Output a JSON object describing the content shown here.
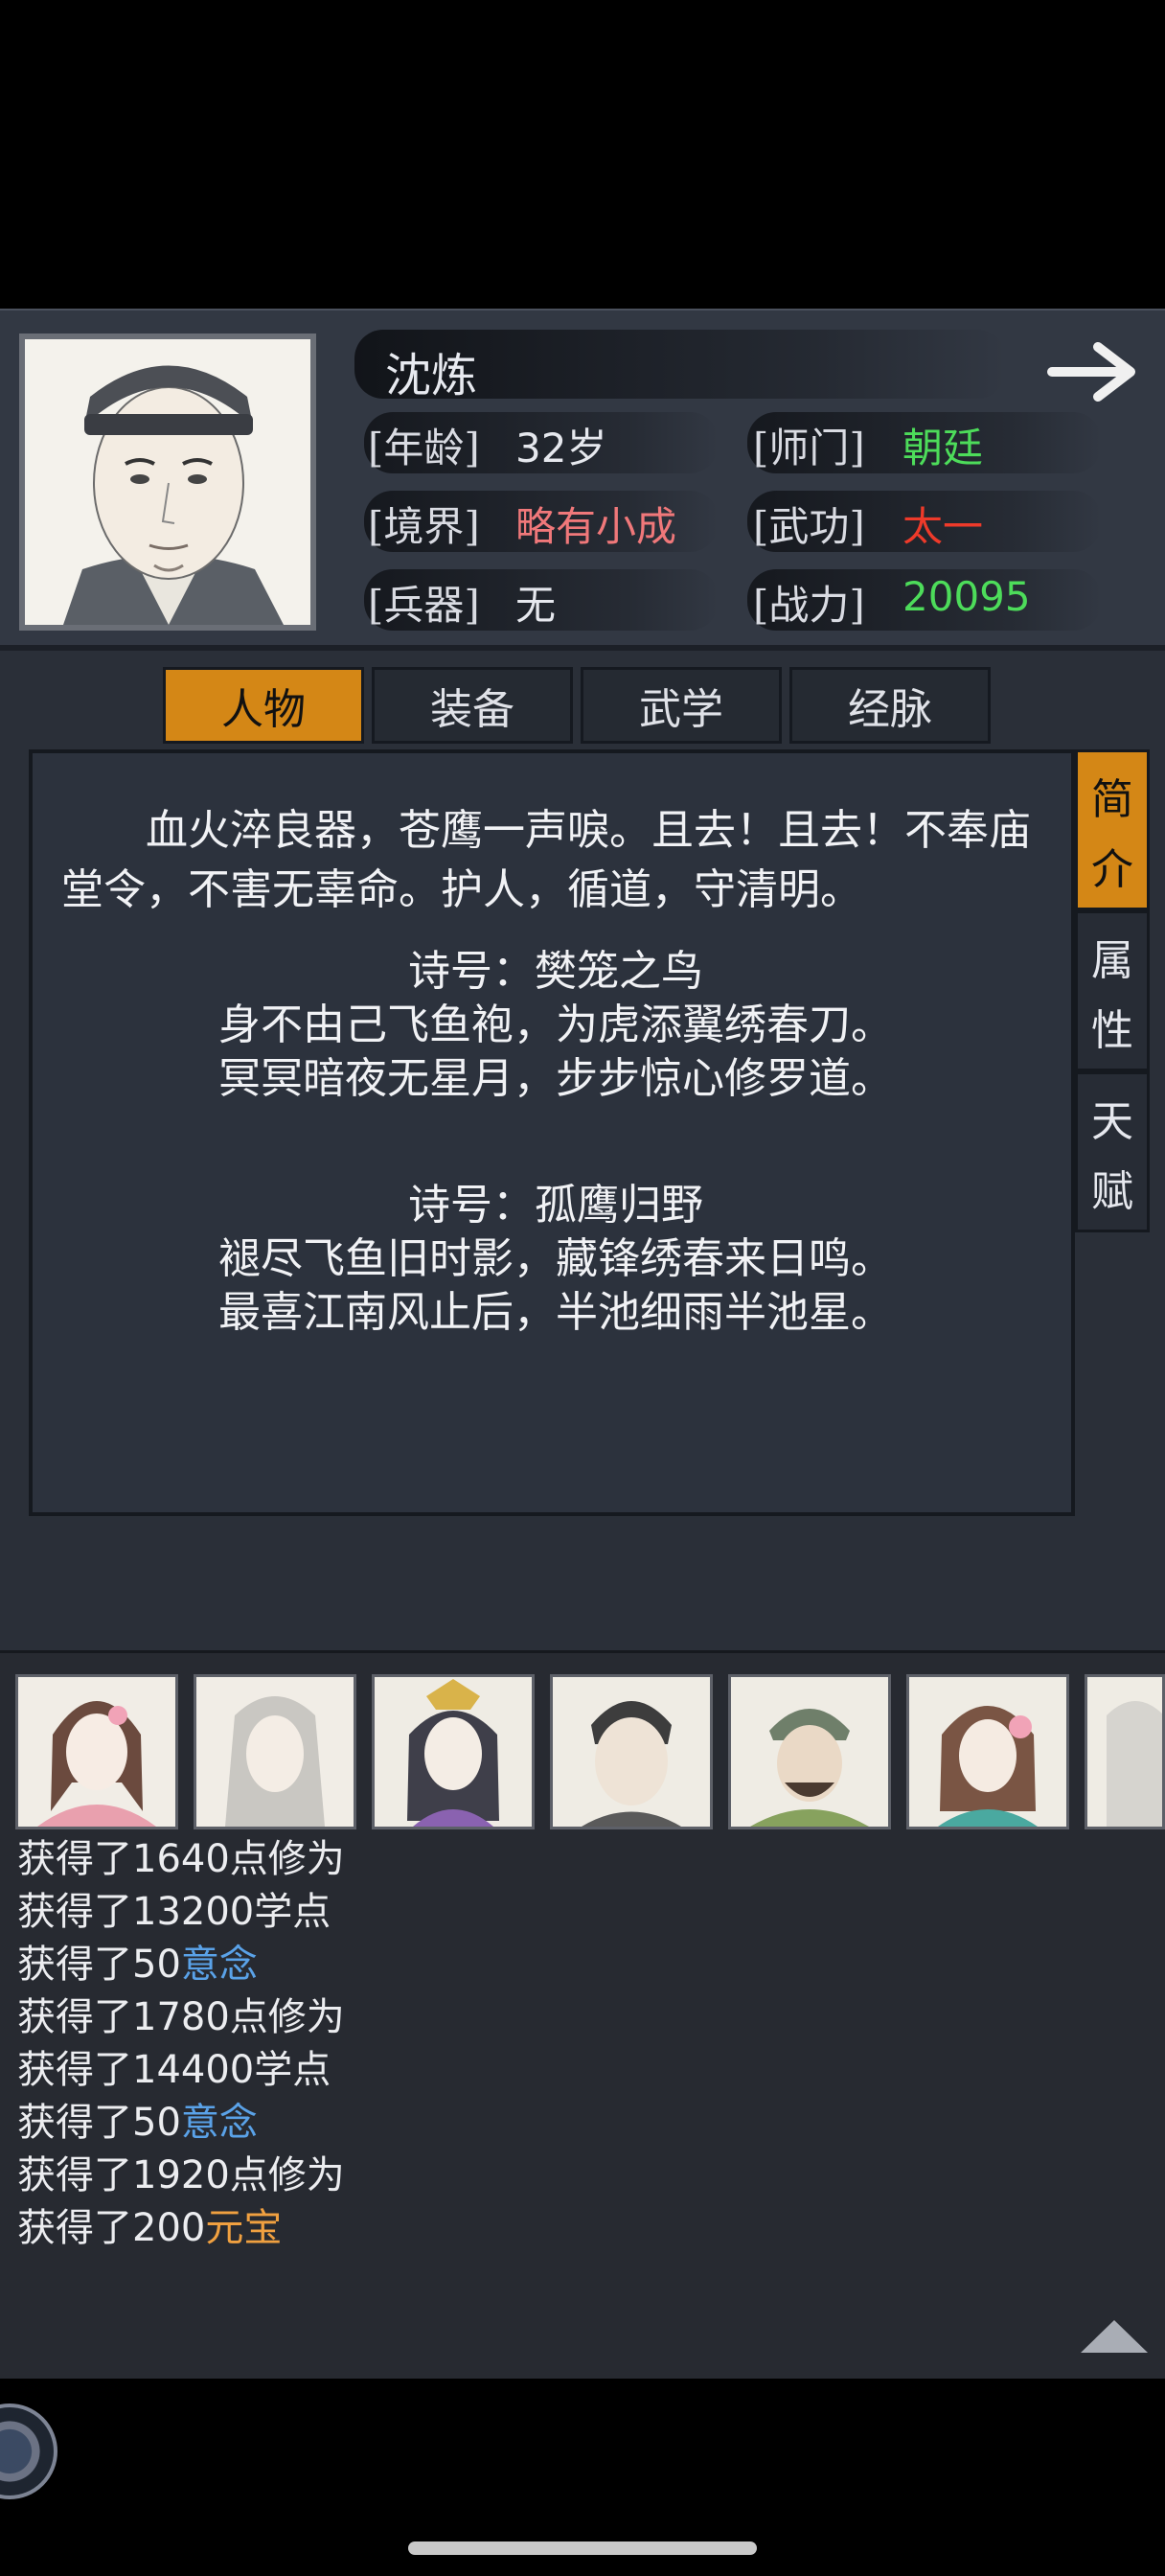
{
  "character": {
    "name": "沈炼",
    "stats": {
      "age_label": "[年龄]",
      "age_value": "32岁",
      "sect_label": "[师门]",
      "sect_value": "朝廷",
      "realm_label": "[境界]",
      "realm_value": "略有小成",
      "martial_label": "[武功]",
      "martial_value": "太一",
      "weapon_label": "[兵器]",
      "weapon_value": "无",
      "power_label": "[战力]",
      "power_value": "20095"
    }
  },
  "tabs": [
    "人物",
    "装备",
    "武学",
    "经脉"
  ],
  "side_tabs": [
    {
      "chars": [
        "简",
        "介"
      ],
      "active": true
    },
    {
      "chars": [
        "属",
        "性"
      ],
      "active": false
    },
    {
      "chars": [
        "天",
        "赋"
      ],
      "active": false
    }
  ],
  "bio": {
    "intro": "血火淬良器，苍鹰一声唳。且去！且去！不奉庙堂令，不害无辜命。护人，循道，守清明。",
    "poem1_title": "诗号：樊笼之鸟",
    "poem1_line1": "身不由己飞鱼袍，为虎添翼绣春刀。",
    "poem1_line2": "冥冥暗夜无星月，步步惊心修罗道。",
    "poem2_title": "诗号：孤鹰归野",
    "poem2_line1": "褪尽飞鱼旧时影，藏锋绣春来日鸣。",
    "poem2_line2": "最喜江南风止后，半池细雨半池星。"
  },
  "log": [
    {
      "prefix": "获得了1640点修为",
      "highlight": "",
      "color": ""
    },
    {
      "prefix": "获得了13200学点",
      "highlight": "",
      "color": ""
    },
    {
      "prefix": "获得了50",
      "highlight": "意念",
      "color": "#5aa2e8"
    },
    {
      "prefix": "获得了1780点修为",
      "highlight": "",
      "color": ""
    },
    {
      "prefix": "获得了14400学点",
      "highlight": "",
      "color": ""
    },
    {
      "prefix": "获得了50",
      "highlight": "意念",
      "color": "#5aa2e8"
    },
    {
      "prefix": "获得了1920点修为",
      "highlight": "",
      "color": ""
    },
    {
      "prefix": "获得了200",
      "highlight": "元宝",
      "color": "#f0a040"
    }
  ],
  "colors": {
    "accent_orange": "#d48716",
    "value_green": "#4ddc5a",
    "value_pink": "#f0787a",
    "value_red": "#ee3a2a"
  }
}
